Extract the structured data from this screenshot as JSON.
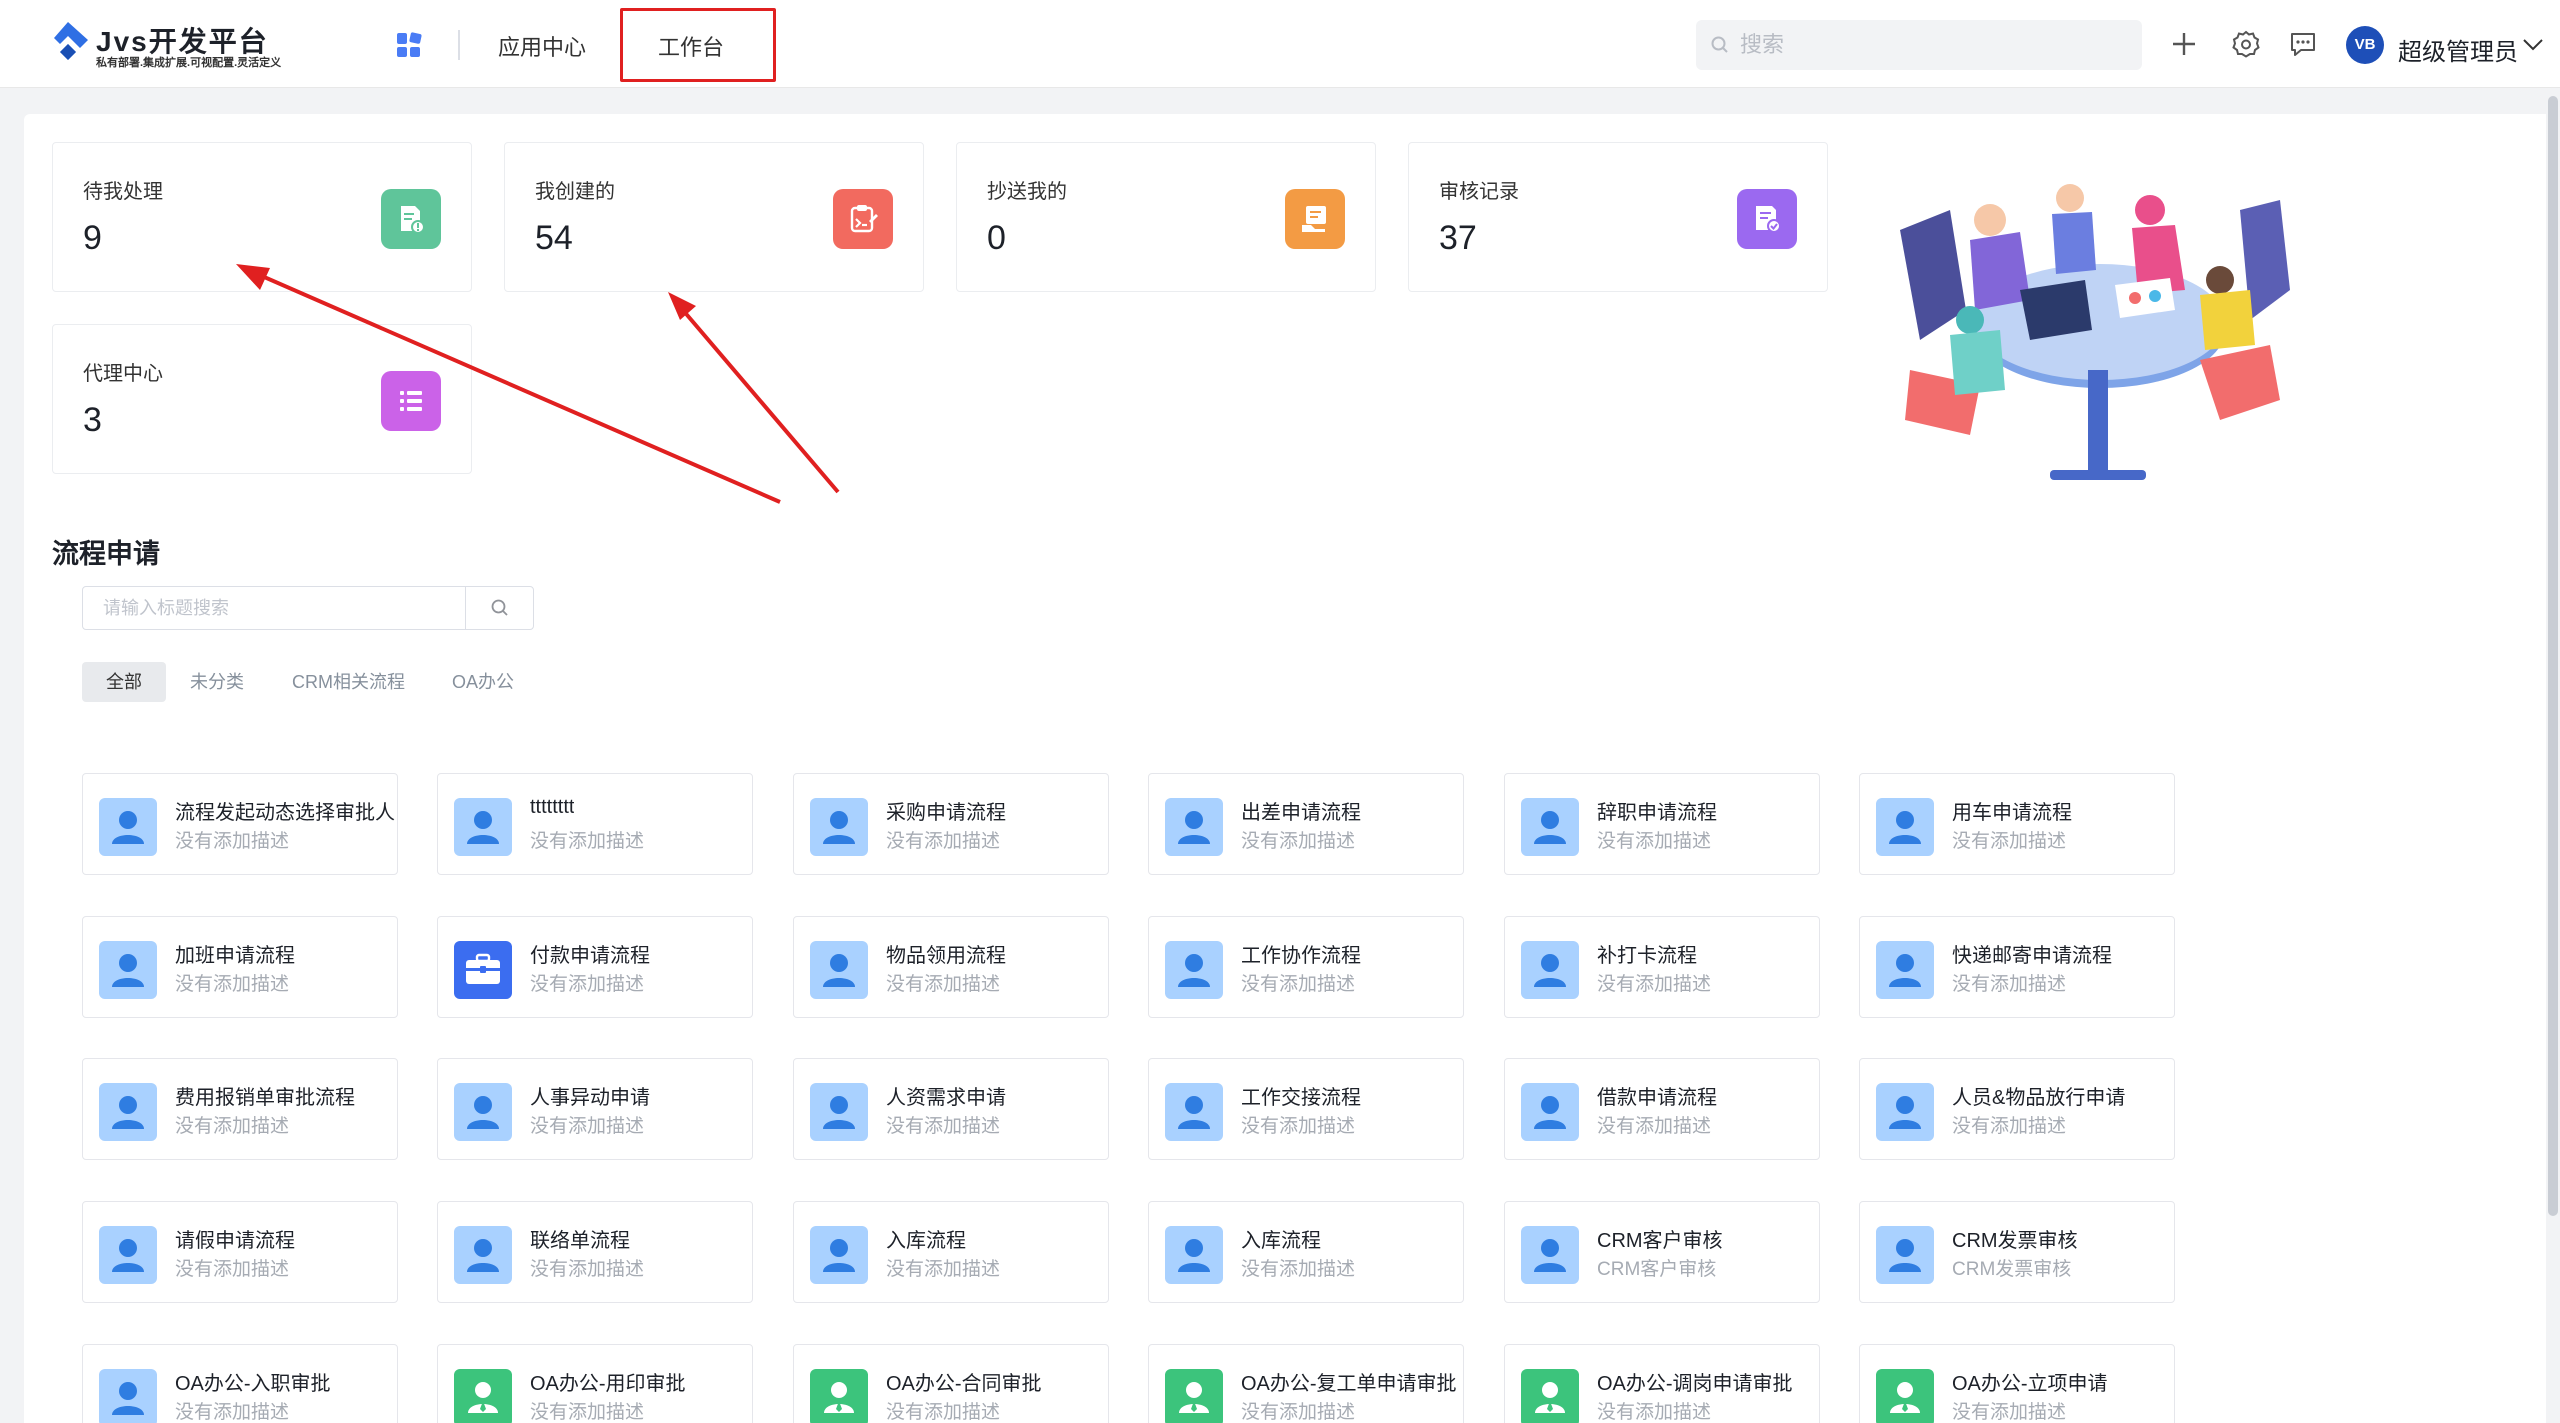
{
  "header": {
    "logo_title": "Jvs开发平台",
    "logo_subtitle": "私有部署.集成扩展.可视配置.灵活定义",
    "nav": {
      "app_center": "应用中心",
      "workbench": "工作台"
    },
    "search_placeholder": "搜索",
    "avatar_text": "VB",
    "user_name": "超级管理员"
  },
  "stats": [
    {
      "label": "待我处理",
      "value": "9",
      "icon": "document-alert-icon",
      "color": "#5fc59a"
    },
    {
      "label": "我创建的",
      "value": "54",
      "icon": "edit-document-icon",
      "color": "#f26a5f"
    },
    {
      "label": "抄送我的",
      "value": "0",
      "icon": "send-document-icon",
      "color": "#f39b44"
    },
    {
      "label": "审核记录",
      "value": "37",
      "icon": "audit-document-icon",
      "color": "#9b69f0"
    },
    {
      "label": "代理中心",
      "value": "3",
      "icon": "list-icon",
      "color": "#cb62e8"
    }
  ],
  "process": {
    "title": "流程申请",
    "search_placeholder": "请输入标题搜索",
    "tabs": [
      "全部",
      "未分类",
      "CRM相关流程",
      "OA办公"
    ],
    "active_tab": "全部",
    "items": [
      {
        "title": "流程发起动态选择审批人",
        "desc": "没有添加描述",
        "icon": "user-icon"
      },
      {
        "title": "tttttttt",
        "desc": "没有添加描述",
        "icon": "user-icon"
      },
      {
        "title": "采购申请流程",
        "desc": "没有添加描述",
        "icon": "user-icon"
      },
      {
        "title": "出差申请流程",
        "desc": "没有添加描述",
        "icon": "user-icon"
      },
      {
        "title": "辞职申请流程",
        "desc": "没有添加描述",
        "icon": "user-icon"
      },
      {
        "title": "用车申请流程",
        "desc": "没有添加描述",
        "icon": "user-icon"
      },
      {
        "title": "加班申请流程",
        "desc": "没有添加描述",
        "icon": "user-icon"
      },
      {
        "title": "付款申请流程",
        "desc": "没有添加描述",
        "icon": "briefcase-icon"
      },
      {
        "title": "物品领用流程",
        "desc": "没有添加描述",
        "icon": "user-icon"
      },
      {
        "title": "工作协作流程",
        "desc": "没有添加描述",
        "icon": "user-icon"
      },
      {
        "title": "补打卡流程",
        "desc": "没有添加描述",
        "icon": "user-icon"
      },
      {
        "title": "快递邮寄申请流程",
        "desc": "没有添加描述",
        "icon": "user-icon"
      },
      {
        "title": "费用报销单审批流程",
        "desc": "没有添加描述",
        "icon": "user-icon"
      },
      {
        "title": "人事异动申请",
        "desc": "没有添加描述",
        "icon": "user-icon"
      },
      {
        "title": "人资需求申请",
        "desc": "没有添加描述",
        "icon": "user-icon"
      },
      {
        "title": "工作交接流程",
        "desc": "没有添加描述",
        "icon": "user-icon"
      },
      {
        "title": "借款申请流程",
        "desc": "没有添加描述",
        "icon": "user-icon"
      },
      {
        "title": "人员&物品放行申请",
        "desc": "没有添加描述",
        "icon": "user-icon"
      },
      {
        "title": "请假申请流程",
        "desc": "没有添加描述",
        "icon": "user-icon"
      },
      {
        "title": "联络单流程",
        "desc": "没有添加描述",
        "icon": "user-icon"
      },
      {
        "title": "入库流程",
        "desc": "没有添加描述",
        "icon": "user-icon"
      },
      {
        "title": "入库流程",
        "desc": "没有添加描述",
        "icon": "user-icon"
      },
      {
        "title": "CRM客户审核",
        "desc": "CRM客户审核",
        "icon": "user-icon"
      },
      {
        "title": "CRM发票审核",
        "desc": "CRM发票审核",
        "icon": "user-icon"
      },
      {
        "title": "OA办公-入职审批",
        "desc": "没有添加描述",
        "icon": "user-icon"
      },
      {
        "title": "OA办公-用印审批",
        "desc": "没有添加描述",
        "icon": "staff-icon"
      },
      {
        "title": "OA办公-合同审批",
        "desc": "没有添加描述",
        "icon": "staff-icon"
      },
      {
        "title": "OA办公-复工单申请审批",
        "desc": "没有添加描述",
        "icon": "staff-icon"
      },
      {
        "title": "OA办公-调岗申请审批",
        "desc": "没有添加描述",
        "icon": "staff-icon"
      },
      {
        "title": "OA办公-立项申请",
        "desc": "没有添加描述",
        "icon": "staff-icon"
      }
    ]
  },
  "colors": {
    "highlight_red": "#e02020",
    "user_icon_bg": "#a9d1ff",
    "briefcase_icon_bg": "#3b6df0",
    "staff_icon_bg": "#3cc47c",
    "brand_blue": "#1e4fb8"
  }
}
